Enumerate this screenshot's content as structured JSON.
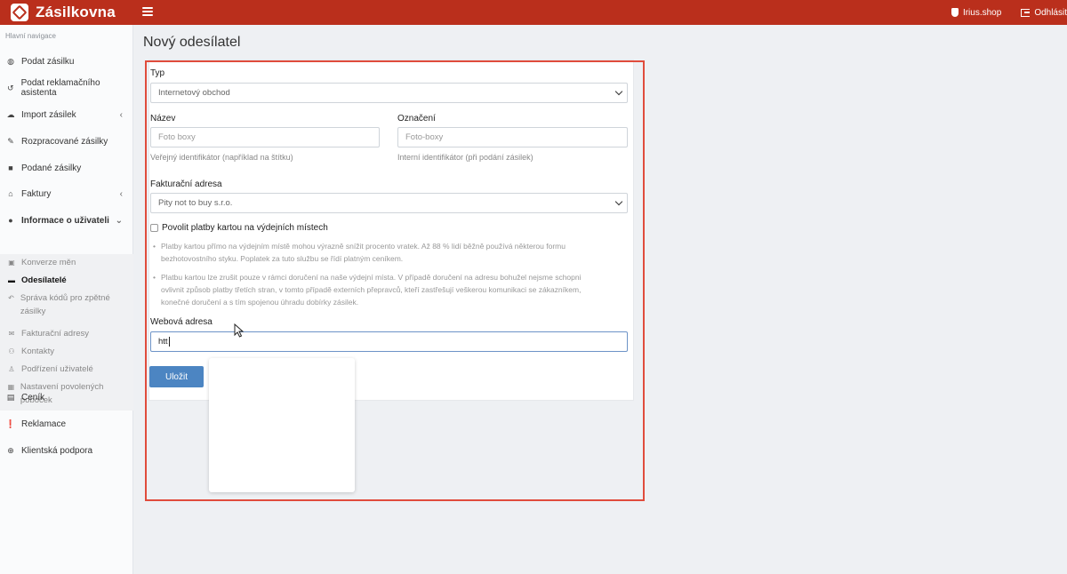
{
  "topbar": {
    "brand": "Zásilkovna",
    "shop": "Irius.shop",
    "logout": "Odhlásit"
  },
  "sidebar": {
    "heading": "Hlavní navigace",
    "items": [
      {
        "label": "Podat zásilku",
        "icon": "globe-icon"
      },
      {
        "label": "Podat reklamačního asistenta",
        "icon": "undo-icon"
      },
      {
        "label": "Import zásilek",
        "icon": "cloud-upload-icon",
        "caret": "‹"
      },
      {
        "label": "Rozpracované zásilky",
        "icon": "edit-icon"
      },
      {
        "label": "Podané zásilky",
        "icon": "box-icon"
      },
      {
        "label": "Faktury",
        "icon": "bank-icon",
        "caret": "‹"
      },
      {
        "label": "Informace o uživateli",
        "icon": "user-icon",
        "caret": "⌄"
      },
      {
        "label": "Ceník",
        "icon": "list-icon"
      },
      {
        "label": "Reklamace",
        "icon": "alert-icon"
      },
      {
        "label": "Klientská podpora",
        "icon": "lifebuoy-icon"
      }
    ],
    "subitems": [
      {
        "label": "Konverze měn",
        "icon": "exchange-icon"
      },
      {
        "label": "Odesílatelé",
        "icon": "truck-icon"
      },
      {
        "label": "Správa kódů pro zpětné zásilky",
        "icon": "reply-icon"
      },
      {
        "label": "Fakturační adresy",
        "icon": "envelope-icon"
      },
      {
        "label": "Kontakty",
        "icon": "users-icon"
      },
      {
        "label": "Podřízení uživatelé",
        "icon": "person-icon"
      },
      {
        "label": "Nastavení povolených poboček",
        "icon": "grid-icon"
      }
    ]
  },
  "page": {
    "title": "Nový odesílatel"
  },
  "form": {
    "typ_label": "Typ",
    "typ_value": "Internetový obchod",
    "nazev_label": "Název",
    "nazev_placeholder": "Foto boxy",
    "nazev_help": "Veřejný identifikátor (například na štítku)",
    "oznaceni_label": "Označení",
    "oznaceni_placeholder": "Foto-boxy",
    "oznaceni_help": "Interní identifikátor (při podání zásilek)",
    "fakt_label": "Fakturační adresa",
    "fakt_value": "Pity not to buy s.r.o.",
    "card_checkbox_label": "Povolit platby kartou na výdejních místech",
    "bullet1_line1": "Platby kartou přímo na výdejním místě mohou výrazně snížit procento vratek. Až 88 % lidí běžně používá některou formu",
    "bullet1_line2": "bezhotovostního styku. Poplatek za tuto službu se řídí platným ceníkem.",
    "bullet2_line1": "Platbu kartou lze zrušit pouze v rámci doručení na naše výdejní místa. V případě doručení na adresu bohužel nejsme schopni",
    "bullet2_line2": "ovlivnit způsob platby třetích stran, v tomto případě externích přepravců, kteří zastřešují veškerou komunikaci se zákazníkem,",
    "bullet2_line3": "konečné doručení a s tím spojenou úhradu dobírky zásilek.",
    "web_label": "Webová adresa",
    "web_value": "htt",
    "save": "Uložit"
  },
  "colors": {
    "brand": "#ba2f1c",
    "primary_button": "#4c85c2",
    "highlight_border": "#e04c3c"
  }
}
